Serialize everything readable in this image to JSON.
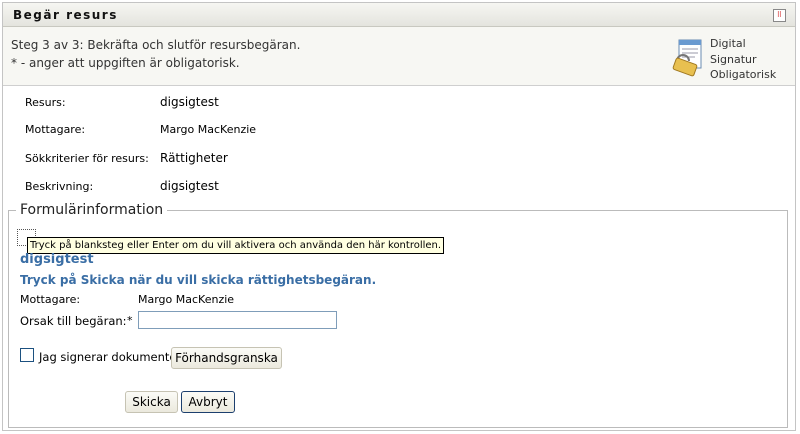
{
  "header": {
    "title": "Begär resurs"
  },
  "info": {
    "step": "Steg 3 av 3: Bekräfta och slutför resursbegäran.",
    "required_note": "* - anger att uppgiften är obligatorisk.",
    "signature": [
      "Digital",
      "Signatur",
      "Obligatorisk"
    ]
  },
  "details": [
    {
      "label": "Resurs:",
      "value": "digsigtest"
    },
    {
      "label": "Mottagare:",
      "value": "Margo MacKenzie"
    },
    {
      "label": "Sökkriterier för resurs:",
      "value": "Rättigheter"
    },
    {
      "label": "Beskrivning:",
      "value": "digsigtest"
    }
  ],
  "form": {
    "legend": "Formulärinformation",
    "tooltip": "Tryck på blanksteg eller Enter om du vill aktivera och använda den här kontrollen.",
    "title": "digsigtest",
    "instruction": "Tryck på Skicka när du vill skicka rättighetsbegäran.",
    "recipient_label": "Mottagare:",
    "recipient_value": "Margo MacKenzie",
    "reason_label": "Orsak till begäran:",
    "required_mark": "*",
    "reason_value": "",
    "sign_label": "Jag signerar dokumentet",
    "preview_button": "Förhandsgranska",
    "submit_button": "Skicka",
    "cancel_button": "Avbryt"
  }
}
